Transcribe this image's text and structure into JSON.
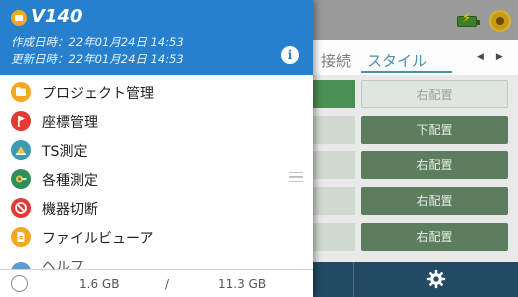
{
  "drawer": {
    "title": "V140",
    "created_line": "作成日時：22年01月24日 14:53",
    "updated_line": "更新日時：22年01月24日 14:53",
    "info_icon": "info-icon",
    "accent_color": "#2780cd",
    "menu_items": [
      {
        "label": "プロジェクト管理",
        "icon": "folder-icon"
      },
      {
        "label": "座標管理",
        "icon": "flag-icon"
      },
      {
        "label": "TS測定",
        "icon": "total-station-icon"
      },
      {
        "label": "各種測定",
        "icon": "measure-icon"
      },
      {
        "label": "機器切断",
        "icon": "disconnect-icon"
      },
      {
        "label": "ファイルビューア",
        "icon": "file-viewer-icon"
      },
      {
        "label": "ヘルプ",
        "icon": "help-icon"
      }
    ],
    "storage": {
      "used": "1.6 GB",
      "separator": "/",
      "total": "11.3 GB"
    }
  },
  "background": {
    "tabs": [
      "接続",
      "スタイル"
    ],
    "active_tab": "スタイル",
    "rows": [
      {
        "value": "右配置",
        "highlighted": false
      },
      {
        "value": "下配置",
        "highlighted": true
      },
      {
        "value": "右配置",
        "highlighted": true
      },
      {
        "value": "右配置",
        "highlighted": true
      },
      {
        "value": "右配置",
        "highlighted": true
      }
    ],
    "footer_icon": "gear-icon"
  }
}
